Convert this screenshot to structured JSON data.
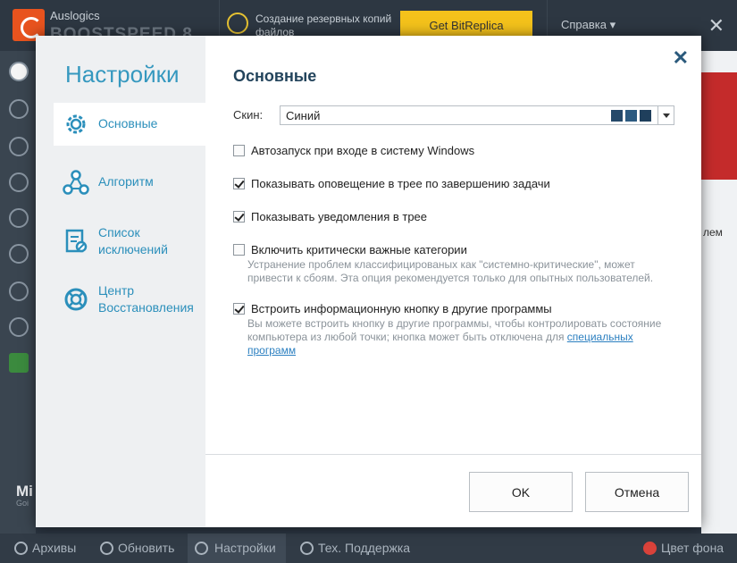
{
  "app": {
    "brand_small": "Auslogics",
    "brand_big": "BOOSTSPEED 8",
    "backup_text": "Создание резервных копий файлов",
    "promo_button": "Get BitReplica",
    "help_menu": "Справка ▾",
    "close_symbol": "✕",
    "right_fragment": "лем",
    "mi_fragment": "Mi",
    "mi_sub": "Goi"
  },
  "bottom_bar": {
    "items": [
      {
        "label": "Архивы",
        "icon": "archive-icon"
      },
      {
        "label": "Обновить",
        "icon": "refresh-icon"
      },
      {
        "label": "Настройки",
        "icon": "gear-icon"
      },
      {
        "label": "Тех. Поддержка",
        "icon": "chat-icon"
      }
    ],
    "bg_color_label": "Цвет фона"
  },
  "dialog": {
    "title": "Настройки",
    "close_symbol": "✕",
    "nav": [
      {
        "label": "Основные",
        "icon": "gear-icon"
      },
      {
        "label": "Алгоритм",
        "icon": "algorithm-icon"
      },
      {
        "label": "Список исключений",
        "icon": "exclusion-list-icon"
      },
      {
        "label": "Центр Восстановления",
        "icon": "lifebuoy-icon"
      }
    ],
    "section_title": "Основные",
    "skin": {
      "label": "Скин:",
      "value": "Синий",
      "swatch_colors": [
        "#25496a",
        "#2c5a80",
        "#1f3f5c"
      ]
    },
    "options": [
      {
        "label": "Автозапуск при входе в систему Windows",
        "checked": false
      },
      {
        "label": "Показывать оповещение в трее по завершению задачи",
        "checked": true
      },
      {
        "label": "Показывать уведомления в трее",
        "checked": true
      },
      {
        "label": "Включить критически важные категории",
        "checked": false,
        "description": "Устранение проблем классифицированых как \"системно-критические\", может привести к сбоям. Эта опция рекомендуется только для опытных пользователей."
      },
      {
        "label": "Встроить информационную кнопку в другие программы",
        "checked": true,
        "description": "Вы можете встроить кнопку в другие программы, чтобы контролировать состояние компьютера из любой точки; кнопка может быть отключена для",
        "link": "специальных программ"
      }
    ],
    "ok_label": "OK",
    "cancel_label": "Отмена"
  },
  "colors": {
    "accent": "#3598bf",
    "title_dark": "#23445c",
    "promo_yellow": "#f4c21b",
    "alert_red": "#c42b2b"
  }
}
